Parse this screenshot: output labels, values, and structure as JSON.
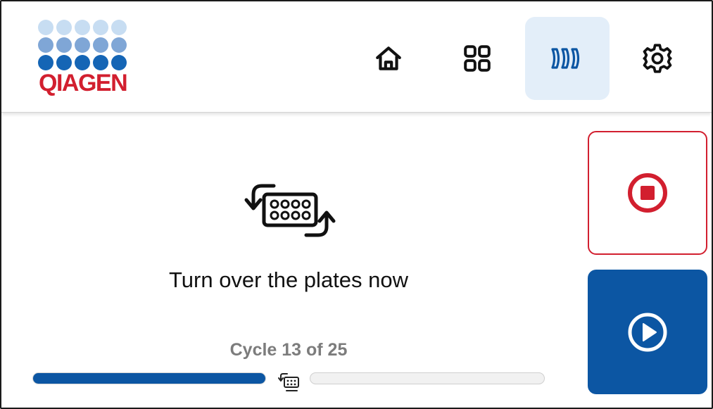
{
  "header": {
    "logo": {
      "text": "QIAGEN",
      "colors": {
        "dots_light": "#c7ddf2",
        "dots_mid": "#7fa6d6",
        "dots_dark": "#1565b5",
        "text": "#d21f2f"
      }
    },
    "nav": [
      {
        "icon": "home-icon",
        "active": false
      },
      {
        "icon": "apps-grid-icon",
        "active": false
      },
      {
        "icon": "plates-icon",
        "active": true
      },
      {
        "icon": "gear-icon",
        "active": false
      }
    ]
  },
  "main": {
    "icon": "turn-over-plates-icon",
    "instruction": "Turn over the plates now",
    "cycle_text": "Cycle 13 of 25",
    "progress": {
      "current": 13,
      "total": 25,
      "fraction": 0.52
    }
  },
  "actions": {
    "stop": {
      "icon": "stop-circle-icon",
      "color": "#d21f2f"
    },
    "play": {
      "icon": "play-circle-icon",
      "color": "#0c56a3"
    }
  }
}
